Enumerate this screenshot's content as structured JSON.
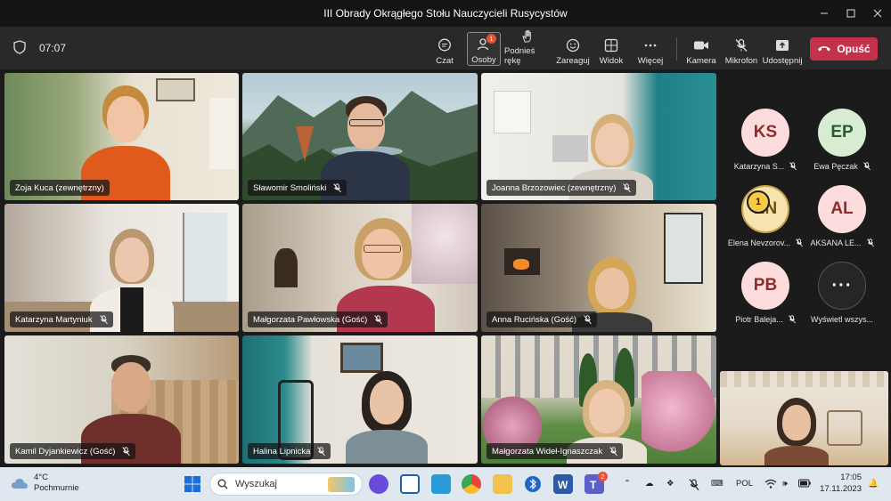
{
  "window": {
    "title": "III Obrady Okrągłego Stołu Nauczycieli Rusycystów",
    "controls": [
      "minimize-icon",
      "maximize-icon",
      "close-icon"
    ]
  },
  "toolbar": {
    "timer": "07:07",
    "buttons": [
      {
        "id": "chat",
        "label": "Czat",
        "icon": "chat-icon"
      },
      {
        "id": "people",
        "label": "Osoby",
        "icon": "people-icon",
        "badge": "1"
      },
      {
        "id": "raise",
        "label": "Podnieś rękę",
        "icon": "raise-hand-icon"
      },
      {
        "id": "react",
        "label": "Zareaguj",
        "icon": "react-icon"
      },
      {
        "id": "view",
        "label": "Widok",
        "icon": "view-icon"
      },
      {
        "id": "more",
        "label": "Więcej",
        "icon": "more-icon"
      },
      {
        "id": "camera",
        "label": "Kamera",
        "icon": "camera-icon"
      },
      {
        "id": "mic",
        "label": "Mikrofon",
        "icon": "mic-off-icon"
      },
      {
        "id": "share",
        "label": "Udostępnij",
        "icon": "share-icon"
      }
    ],
    "leave_label": "Opuść"
  },
  "tiles": [
    {
      "name": "Zoja Kuca (zewnętrzny)",
      "muted": false,
      "speaking": true
    },
    {
      "name": "Sławomir Smoliński",
      "muted": true
    },
    {
      "name": "Joanna Brzozowiec (zewnętrzny)",
      "muted": true
    },
    {
      "name": "Katarzyna Martyniuk",
      "muted": true
    },
    {
      "name": "Małgorzata Pawłowska (Gość)",
      "muted": true
    },
    {
      "name": "Anna Rucińska (Gość)",
      "muted": true
    },
    {
      "name": "Kamil Dyjankiewicz (Gość)",
      "muted": true
    },
    {
      "name": "Halina Lipnicka",
      "muted": true
    },
    {
      "name": "Małgorzata Wideł-Ignaszczak",
      "muted": true
    }
  ],
  "roster": [
    {
      "initials": "KS",
      "name": "Katarzyna S...",
      "muted": true
    },
    {
      "initials": "EP",
      "name": "Ewa Pęczak",
      "muted": true
    },
    {
      "initials": "EN",
      "name": "Elena Nevzorov...",
      "muted": true,
      "hand_raised": "1"
    },
    {
      "initials": "AL",
      "name": "AKSANA LE...",
      "muted": true
    },
    {
      "initials": "PB",
      "name": "Piotr Baleja...",
      "muted": true
    },
    {
      "initials": "···",
      "name": "Wyświetl wszys..."
    }
  ],
  "taskbar": {
    "weather_temp": "4°C",
    "weather_desc": "Pochmurnie",
    "search_placeholder": "Wyszukaj",
    "teams_badge": "2",
    "language": "POL",
    "time": "17:05",
    "date": "17.11.2023"
  },
  "colors": {
    "leave_button": "#c4314b",
    "speaking_outline": "#7f85f5",
    "badge": "#e5533d"
  }
}
